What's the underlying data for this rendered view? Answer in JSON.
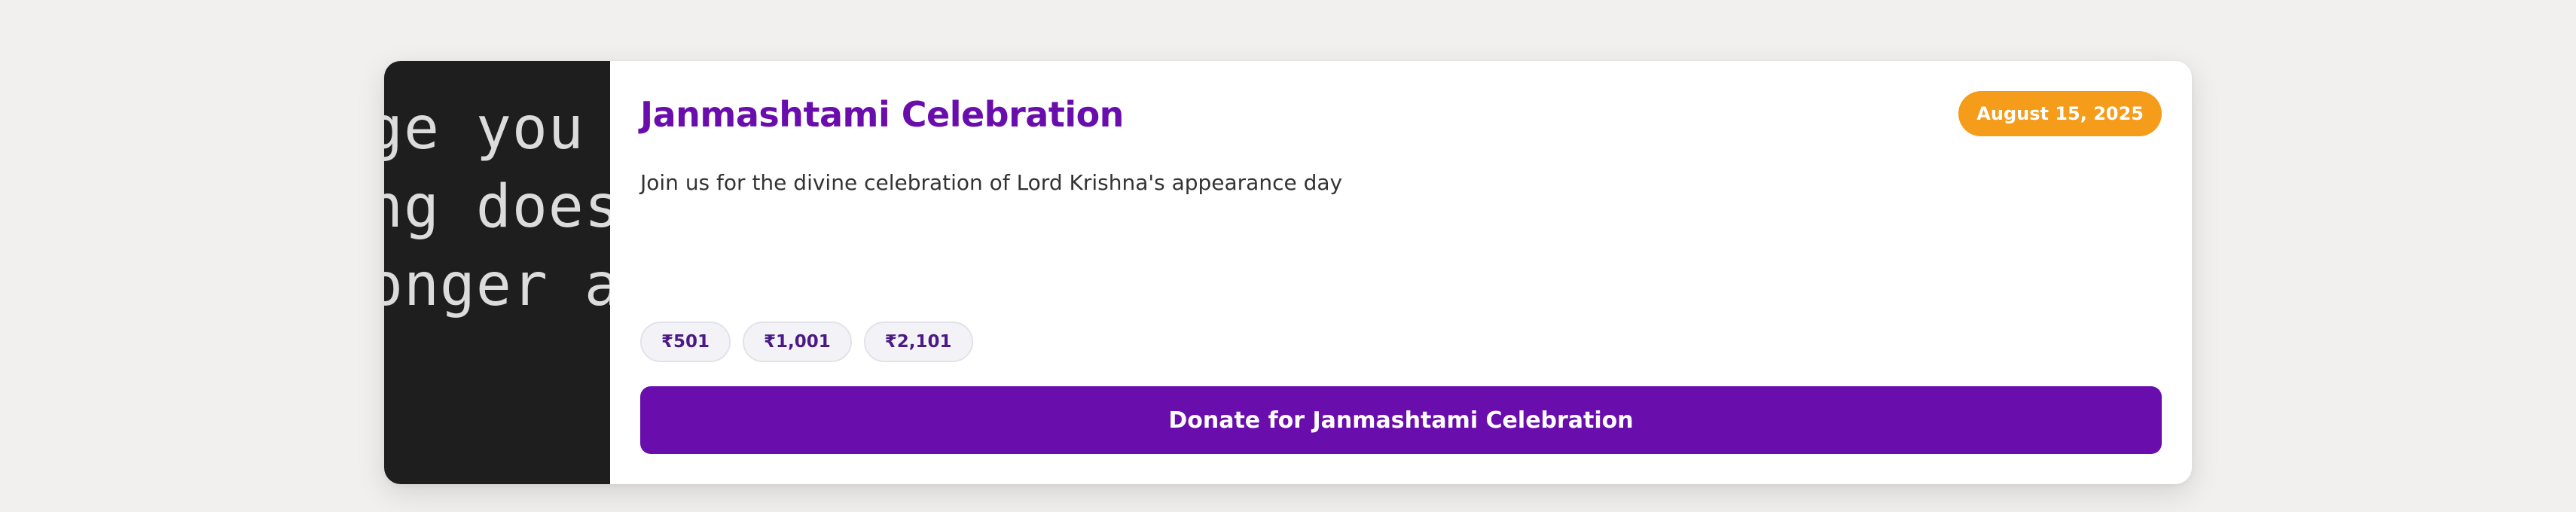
{
  "event": {
    "thumbnail_text": "ge you a\nng does\nonger a",
    "title": "Janmashtami Celebration",
    "date": "August 15, 2025",
    "description": "Join us for the divine celebration of Lord Krishna's appearance day",
    "amounts": [
      "₹501",
      "₹1,001",
      "₹2,101"
    ],
    "donate_label": "Donate for Janmashtami Celebration"
  },
  "colors": {
    "primary": "#6a0dad",
    "badge": "#f59c1a",
    "thumbnail_bg": "#1e1e1e",
    "page_bg": "#f1f0ee"
  }
}
